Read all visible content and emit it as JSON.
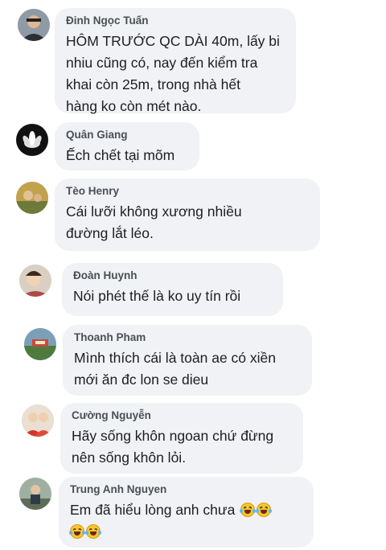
{
  "comments": [
    {
      "name": "Đinh Ngọc Tuấn",
      "text": "HÔM TRƯỚC QC DÀI 40m, lấy bi\nnhiu cũng có, nay đến kiểm tra\nkhai còn 25m, trong nhà hết\nhàng ko còn mét nào."
    },
    {
      "name": "Quân Giang",
      "text": "Ếch chết tại mõm"
    },
    {
      "name": "Tèo Henry",
      "text": "Cái lưỡi không xương nhiều\nđường lắt léo."
    },
    {
      "name": "Đoàn Huynh",
      "text": "Nói phét thế là ko uy tín rồi"
    },
    {
      "name": "Thoanh Pham",
      "text": "Mình thích cái là toàn ae có xiền\nmới ăn đc lon se dieu"
    },
    {
      "name": "Cường Nguyễn",
      "text": "Hãy sống khôn ngoan chứ đừng\nnên sống khôn lỏi."
    },
    {
      "name": "Trung Anh Nguyen",
      "text": "Em đã hiểu lòng anh chưa",
      "emoji": "rolling-on-floor-laughing"
    }
  ],
  "colors": {
    "bubble_bg": "#f0f2f5",
    "name_text": "#4b4f56",
    "body_text": "#1c1e21",
    "emoji_face": "#f7c531"
  }
}
